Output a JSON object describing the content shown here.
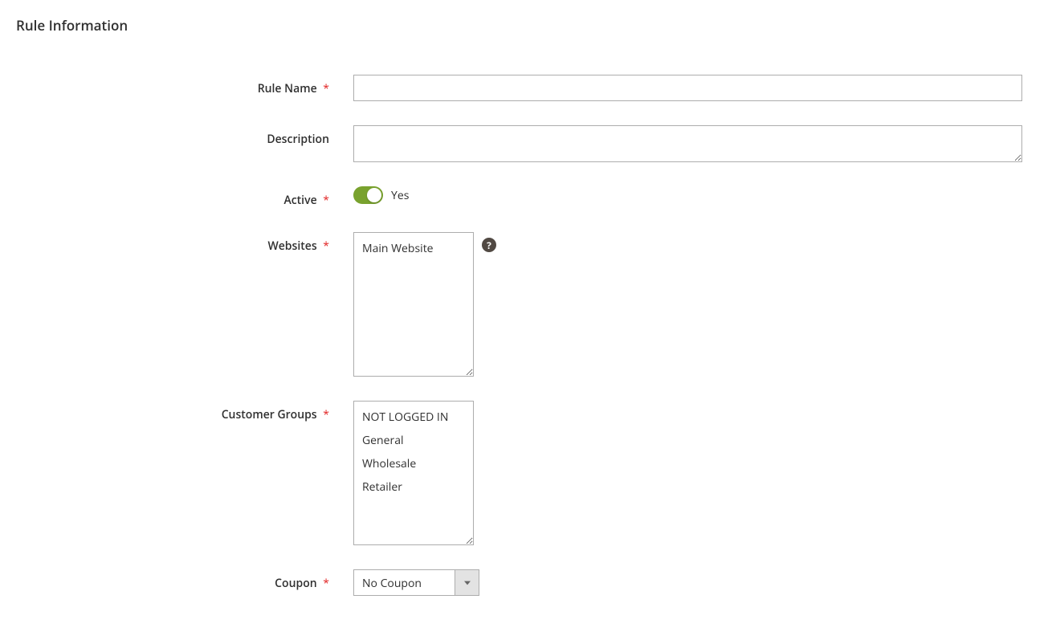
{
  "section": {
    "title": "Rule Information"
  },
  "fields": {
    "rule_name": {
      "label": "Rule Name",
      "value": ""
    },
    "description": {
      "label": "Description",
      "value": ""
    },
    "active": {
      "label": "Active",
      "state_label": "Yes"
    },
    "websites": {
      "label": "Websites",
      "options": [
        "Main Website"
      ]
    },
    "customer_groups": {
      "label": "Customer Groups",
      "options": [
        "NOT LOGGED IN",
        "General",
        "Wholesale",
        "Retailer"
      ]
    },
    "coupon": {
      "label": "Coupon",
      "selected": "No Coupon"
    }
  },
  "required_mark": "*",
  "help_icon": "?"
}
